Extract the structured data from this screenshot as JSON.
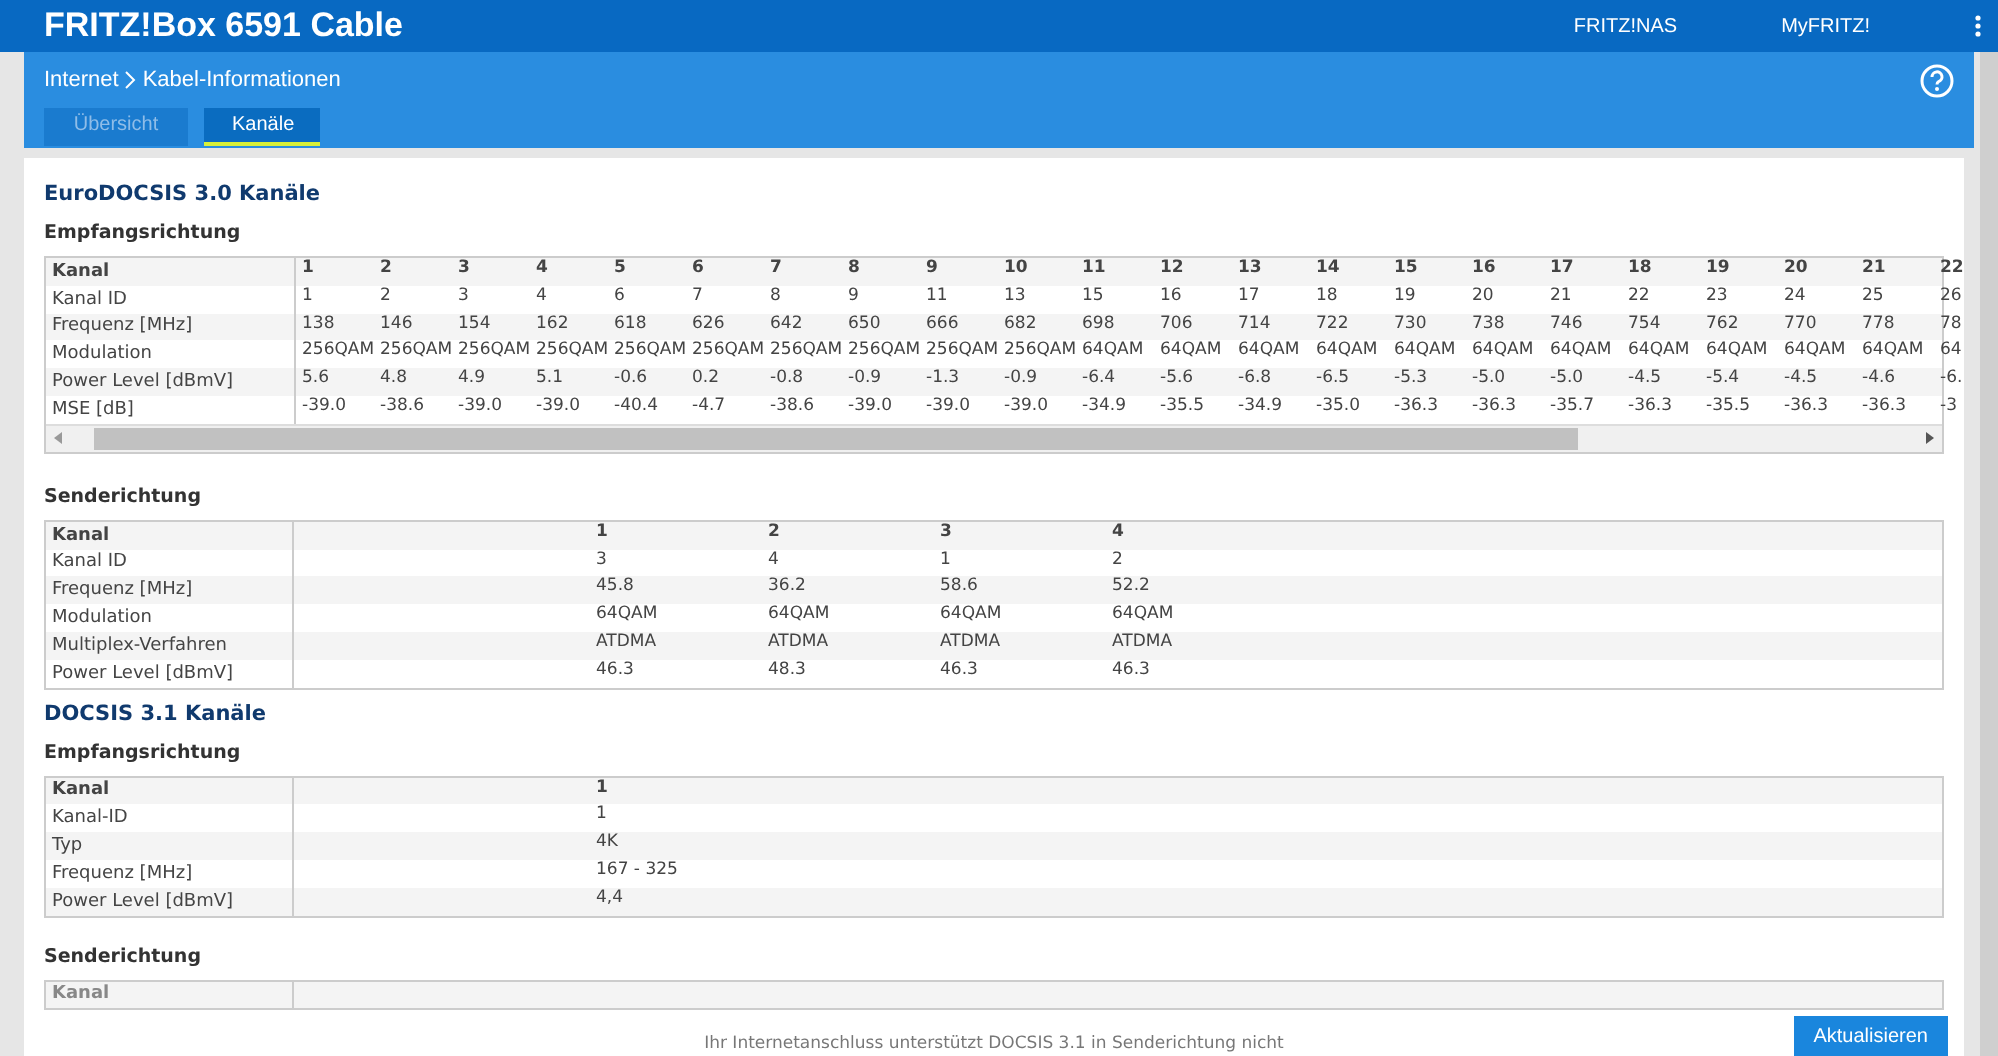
{
  "header": {
    "title": "FRITZ!Box 6591 Cable",
    "links": [
      "FRITZ!NAS",
      "MyFRITZ!"
    ]
  },
  "breadcrumb": {
    "items": [
      "Internet",
      "Kabel-Informationen"
    ]
  },
  "tabs": [
    {
      "label": "Übersicht",
      "selected": false
    },
    {
      "label": "Kanäle",
      "selected": true
    }
  ],
  "sections": [
    {
      "title": "EuroDOCSIS 3.0 Kanäle",
      "tables": [
        {
          "title": "Empfangsrichtung",
          "kind": "wide",
          "rows": [
            {
              "label": "Kanal",
              "cells": [
                "1",
                "2",
                "3",
                "4",
                "5",
                "6",
                "7",
                "8",
                "9",
                "10",
                "11",
                "12",
                "13",
                "14",
                "15",
                "16",
                "17",
                "18",
                "19",
                "20",
                "21",
                "22"
              ]
            },
            {
              "label": "Kanal ID",
              "cells": [
                "1",
                "2",
                "3",
                "4",
                "6",
                "7",
                "8",
                "9",
                "11",
                "13",
                "15",
                "16",
                "17",
                "18",
                "19",
                "20",
                "21",
                "22",
                "23",
                "24",
                "25",
                "26"
              ]
            },
            {
              "label": "Frequenz [MHz]",
              "cells": [
                "138",
                "146",
                "154",
                "162",
                "618",
                "626",
                "642",
                "650",
                "666",
                "682",
                "698",
                "706",
                "714",
                "722",
                "730",
                "738",
                "746",
                "754",
                "762",
                "770",
                "778",
                "78"
              ]
            },
            {
              "label": "Modulation",
              "cells": [
                "256QAM",
                "256QAM",
                "256QAM",
                "256QAM",
                "256QAM",
                "256QAM",
                "256QAM",
                "256QAM",
                "256QAM",
                "256QAM",
                "64QAM",
                "64QAM",
                "64QAM",
                "64QAM",
                "64QAM",
                "64QAM",
                "64QAM",
                "64QAM",
                "64QAM",
                "64QAM",
                "64QAM",
                "64"
              ]
            },
            {
              "label": "Power Level [dBmV]",
              "cells": [
                "5.6",
                "4.8",
                "4.9",
                "5.1",
                "-0.6",
                "0.2",
                "-0.8",
                "-0.9",
                "-1.3",
                "-0.9",
                "-6.4",
                "-5.6",
                "-6.8",
                "-6.5",
                "-5.3",
                "-5.0",
                "-5.0",
                "-4.5",
                "-5.4",
                "-4.5",
                "-4.6",
                "-6."
              ]
            },
            {
              "label": "MSE [dB]",
              "cells": [
                "-39.0",
                "-38.6",
                "-39.0",
                "-39.0",
                "-40.4",
                "-4.7",
                "-38.6",
                "-39.0",
                "-39.0",
                "-39.0",
                "-34.9",
                "-35.5",
                "-34.9",
                "-35.0",
                "-36.3",
                "-36.3",
                "-35.7",
                "-36.3",
                "-35.5",
                "-36.3",
                "-36.3",
                "-3"
              ]
            }
          ]
        },
        {
          "title": "Senderichtung",
          "kind": "narrow",
          "rows": [
            {
              "label": "Kanal",
              "cells": [
                "1",
                "2",
                "3",
                "4"
              ]
            },
            {
              "label": "Kanal ID",
              "cells": [
                "3",
                "4",
                "1",
                "2"
              ]
            },
            {
              "label": "Frequenz [MHz]",
              "cells": [
                "45.8",
                "36.2",
                "58.6",
                "52.2"
              ]
            },
            {
              "label": "Modulation",
              "cells": [
                "64QAM",
                "64QAM",
                "64QAM",
                "64QAM"
              ]
            },
            {
              "label": "Multiplex-Verfahren",
              "cells": [
                "ATDMA",
                "ATDMA",
                "ATDMA",
                "ATDMA"
              ]
            },
            {
              "label": "Power Level [dBmV]",
              "cells": [
                "46.3",
                "48.3",
                "46.3",
                "46.3"
              ]
            }
          ]
        }
      ]
    },
    {
      "title": "DOCSIS 3.1 Kanäle",
      "tables": [
        {
          "title": "Empfangsrichtung",
          "kind": "narrow",
          "rows": [
            {
              "label": "Kanal",
              "cells": [
                "1"
              ]
            },
            {
              "label": "Kanal-ID",
              "cells": [
                "1"
              ]
            },
            {
              "label": "Typ",
              "cells": [
                "4K"
              ]
            },
            {
              "label": "Frequenz [MHz]",
              "cells": [
                "167 - 325"
              ]
            },
            {
              "label": "Power Level [dBmV]",
              "cells": [
                "4,4"
              ]
            }
          ]
        },
        {
          "title": "Senderichtung",
          "kind": "faded",
          "rows": [
            {
              "label": "Kanal",
              "cells": []
            }
          ],
          "message": "Ihr Internetanschluss unterstützt DOCSIS 3.1 in Senderichtung nicht"
        }
      ]
    }
  ],
  "footer": {
    "button": "Aktualisieren"
  }
}
